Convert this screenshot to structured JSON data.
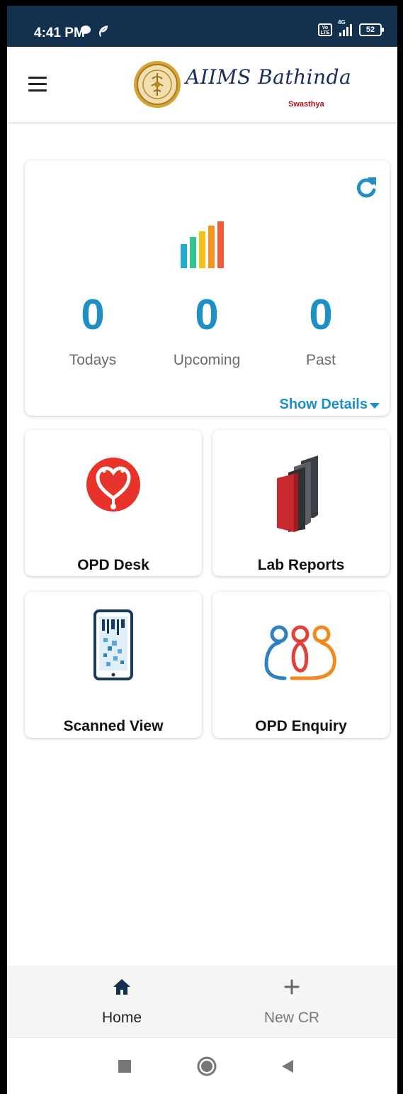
{
  "status_bar": {
    "time": "4:41 PM",
    "network": "4G",
    "volte": "Vo LTE",
    "battery": "52",
    "icons": [
      "chat-bubble-icon",
      "leaf-icon",
      "volte-icon",
      "signal-icon",
      "battery-icon"
    ]
  },
  "app_bar": {
    "brand": "AIIMS Bathinda",
    "tagline": "Swasthya",
    "menu_icon": "hamburger-menu-icon",
    "logo": "aiims-emblem-logo"
  },
  "appointments": {
    "refresh_icon": "refresh-icon",
    "chart_icon": "bar-chart-icon",
    "stats": [
      {
        "count": "0",
        "label": "Todays"
      },
      {
        "count": "0",
        "label": "Upcoming"
      },
      {
        "count": "0",
        "label": "Past"
      }
    ],
    "show_details": "Show Details"
  },
  "tiles": [
    {
      "label": "OPD Desk",
      "icon": "stethoscope-heart-icon"
    },
    {
      "label": "Lab Reports",
      "icon": "books-icon"
    },
    {
      "label": "Scanned View",
      "icon": "tablet-qr-icon"
    },
    {
      "label": "OPD Enquiry",
      "icon": "people-group-icon"
    }
  ],
  "bottom_nav": [
    {
      "label": "Home",
      "icon": "home-icon",
      "active": true
    },
    {
      "label": "New CR",
      "icon": "plus-icon",
      "active": false
    }
  ],
  "system_nav": [
    "recent-apps-icon",
    "home-circle-icon",
    "back-icon"
  ],
  "colors": {
    "status_bar": "#13304e",
    "accent": "#1d91c4",
    "brand_text": "#1c2b63",
    "tagline": "#b41414",
    "opd_red": "#e8332b",
    "books_red": "#c9282c",
    "books_dark": "#3b3f45",
    "tablet_navy": "#173a5e",
    "enquiry_blue": "#2f7fc1",
    "enquiry_red": "#e0403a",
    "enquiry_orange": "#f08a1c"
  }
}
